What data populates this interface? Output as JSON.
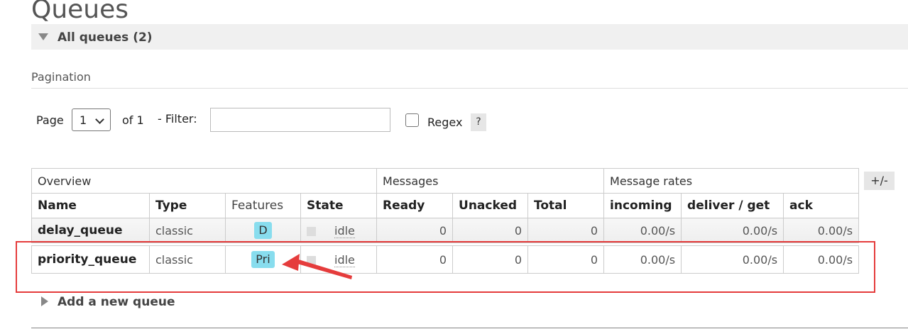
{
  "page": {
    "title": "Queues",
    "section_title": "All queues (2)",
    "add_queue_label": "Add a new queue"
  },
  "pagination": {
    "label": "Pagination",
    "page_label": "Page",
    "page_value": "1",
    "of_label": "of 1",
    "filter_label": "- Filter:",
    "filter_value": "",
    "regex_label": "Regex",
    "regex_checked": false,
    "help_label": "?"
  },
  "table": {
    "groups": {
      "overview": "Overview",
      "messages": "Messages",
      "rates": "Message rates"
    },
    "columns": {
      "name": "Name",
      "type": "Type",
      "features": "Features",
      "state": "State",
      "ready": "Ready",
      "unacked": "Unacked",
      "total": "Total",
      "incoming": "incoming",
      "deliver_get": "deliver / get",
      "ack": "ack"
    },
    "toggle_columns_label": "+/-",
    "rows": [
      {
        "name": "delay_queue",
        "type": "classic",
        "feature": "D",
        "state": "idle",
        "ready": "0",
        "unacked": "0",
        "total": "0",
        "incoming": "0.00/s",
        "deliver_get": "0.00/s",
        "ack": "0.00/s"
      },
      {
        "name": "priority_queue",
        "type": "classic",
        "feature": "Pri",
        "state": "idle",
        "ready": "0",
        "unacked": "0",
        "total": "0",
        "incoming": "0.00/s",
        "deliver_get": "0.00/s",
        "ack": "0.00/s"
      }
    ]
  },
  "colors": {
    "feature_badge": "#88ddee",
    "annotation": "#e53c3c",
    "section_bar": "#f0f0f0"
  }
}
